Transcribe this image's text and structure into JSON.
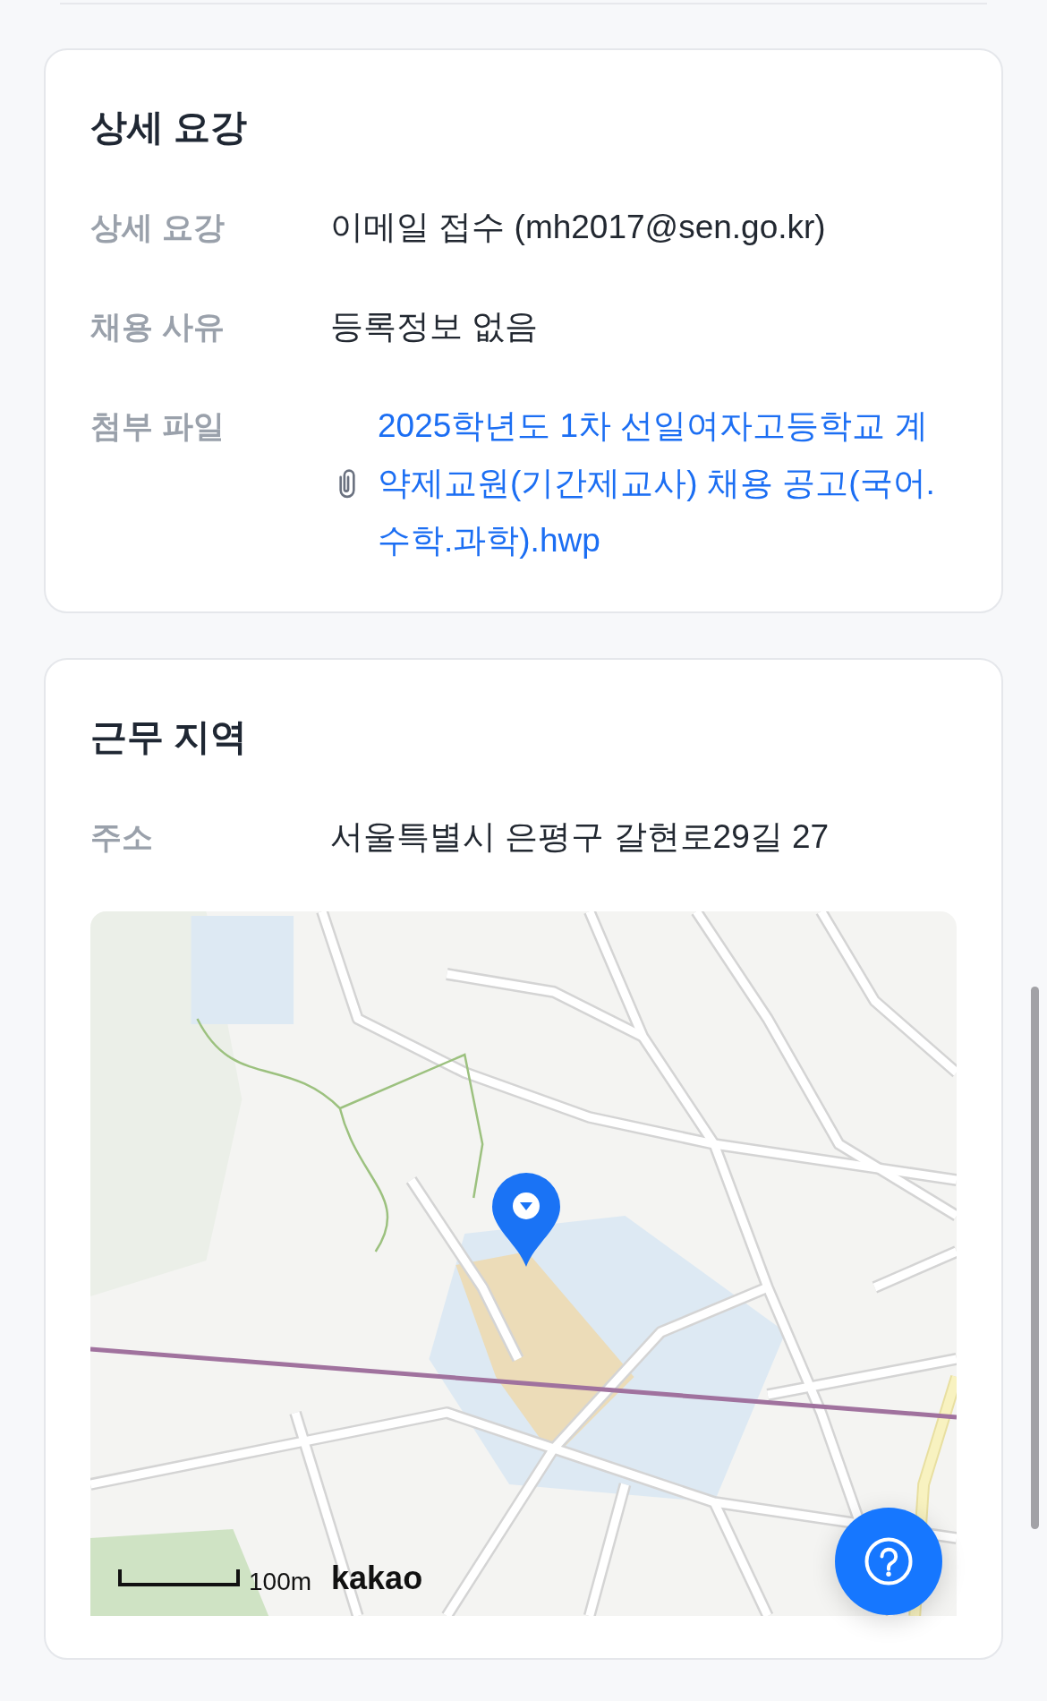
{
  "sections": [
    {
      "title": "상세 요강",
      "rows": [
        {
          "kind": "text",
          "label": "상세 요강",
          "value": "이메일 접수 (mh2017@sen.go.kr)"
        },
        {
          "kind": "text",
          "label": "채용 사유",
          "value": "등록정보 없음"
        },
        {
          "kind": "file",
          "label": "첨부 파일",
          "value": "2025학년도 1차 선일여자고등학교 계약제교원(기간제교사) 채용 공고(국어.수학.과학).hwp"
        }
      ]
    },
    {
      "title": "근무 지역",
      "rows": [
        {
          "kind": "text",
          "label": "주소",
          "value": "서울특별시 은평구 갈현로29길 27"
        }
      ],
      "map": {
        "scale": "100m",
        "logo": "kakao"
      }
    }
  ]
}
